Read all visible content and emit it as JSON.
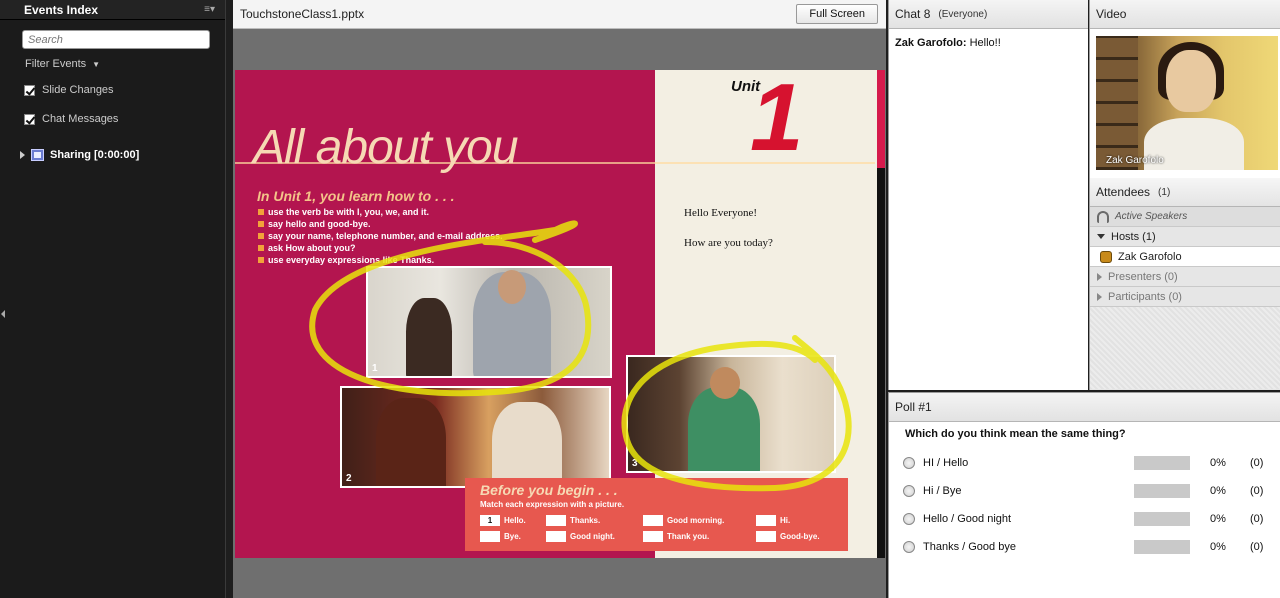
{
  "events_index": {
    "title": "Events Index",
    "search_placeholder": "Search",
    "filter_label": "Filter Events",
    "filters": [
      {
        "label": "Slide Changes",
        "checked": true
      },
      {
        "label": "Chat Messages",
        "checked": true
      }
    ],
    "sharing_item": "Sharing [0:00:00]"
  },
  "share": {
    "filename": "TouchstoneClass1.pptx",
    "fullscreen_label": "Full Screen",
    "slide": {
      "title": "All about you",
      "unit_label": "Unit",
      "unit_number": "1",
      "learn_heading": "In Unit 1, you learn how to . . .",
      "bullets": [
        "use the verb be with I, you, we, and it.",
        "say hello and good-bye.",
        "say your name, telephone number, and e-mail address.",
        "ask How about you?",
        "use everyday expressions like Thanks."
      ],
      "note_1": "Hello Everyone!",
      "note_2": "How are you today?",
      "photo_numbers": [
        "1",
        "2",
        "3"
      ],
      "before_title": "Before you begin . . .",
      "before_sub": "Match each expression with a picture.",
      "answers": [
        {
          "box": "1",
          "label": "Hello."
        },
        {
          "box": "",
          "label": "Thanks."
        },
        {
          "box": "",
          "label": "Good morning."
        },
        {
          "box": "",
          "label": "Hi."
        },
        {
          "box": "",
          "label": "Bye."
        },
        {
          "box": "",
          "label": "Good night."
        },
        {
          "box": "",
          "label": "Thank you."
        },
        {
          "box": "",
          "label": "Good-bye."
        }
      ],
      "annotation_color": "#e8e40a"
    }
  },
  "chat": {
    "title": "Chat",
    "count": "8",
    "scope": "(Everyone)",
    "messages": [
      {
        "sender": "Zak Garofolo:",
        "text": "Hello!!"
      }
    ]
  },
  "video": {
    "title": "Video",
    "caption": "Zak Garofolo"
  },
  "attendees": {
    "title": "Attendees",
    "count": "(1)",
    "active_speakers": "Active Speakers",
    "hosts": "Hosts (1)",
    "host_name": "Zak Garofolo",
    "presenters": "Presenters (0)",
    "participants": "Participants (0)"
  },
  "poll": {
    "title": "Poll #1",
    "question": "Which do you think mean the same thing?",
    "options": [
      {
        "label": "HI / Hello",
        "percent": "0%",
        "count": "(0)"
      },
      {
        "label": "Hi / Bye",
        "percent": "0%",
        "count": "(0)"
      },
      {
        "label": "Hello / Good night",
        "percent": "0%",
        "count": "(0)"
      },
      {
        "label": "Thanks / Good bye",
        "percent": "0%",
        "count": "(0)"
      }
    ]
  }
}
